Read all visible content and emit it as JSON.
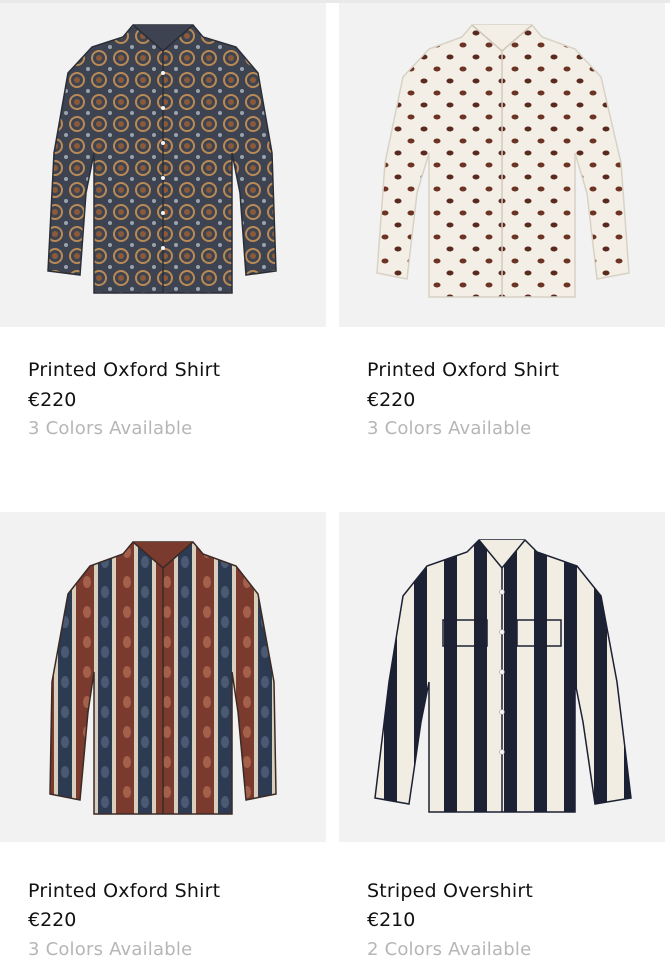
{
  "products": [
    {
      "name": "Printed Oxford Shirt",
      "price": "€220",
      "availability": "3 Colors Available",
      "image_icon": "shirt-medallion-print-icon",
      "colors": {
        "base": "#3d4350",
        "accent": "#b98a55",
        "dot": "#8a5a3a"
      }
    },
    {
      "name": "Printed Oxford Shirt",
      "price": "€220",
      "availability": "3 Colors Available",
      "image_icon": "shirt-paisley-dot-print-icon",
      "colors": {
        "base": "#f3efe6",
        "accent": "#5a2a1e"
      }
    },
    {
      "name": "Printed Oxford Shirt",
      "price": "€220",
      "availability": "3 Colors Available",
      "image_icon": "shirt-paisley-stripe-print-icon",
      "colors": {
        "base": "#7a3b2e",
        "accent": "#2d3b52",
        "light": "#d9cdbb"
      }
    },
    {
      "name": "Striped Overshirt",
      "price": "€210",
      "availability": "2 Colors Available",
      "image_icon": "shirt-vertical-stripe-icon",
      "colors": {
        "base": "#f1ede3",
        "accent": "#1c2133"
      }
    }
  ]
}
